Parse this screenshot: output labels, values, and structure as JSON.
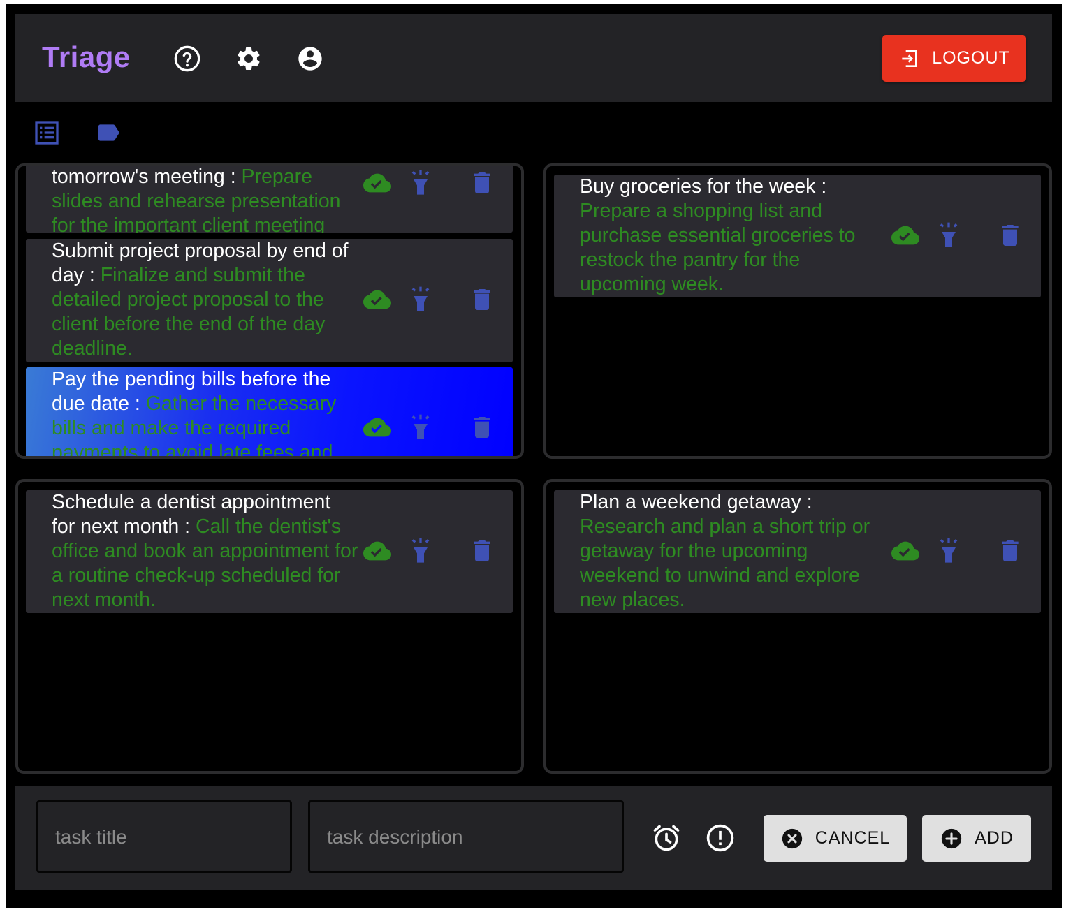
{
  "app": {
    "title": "Triage",
    "logout_label": "LOGOUT",
    "colors": {
      "brand": "#b07cf5",
      "logout": "#e8321f",
      "description_text": "#2e8b22",
      "icon_blue": "#3f51b5",
      "cloud_green": "#2e8b22"
    }
  },
  "header_icons": [
    "help-circle-icon",
    "gear-icon",
    "account-circle-icon"
  ],
  "view_icons": [
    "list-icon",
    "label-icon"
  ],
  "panels": [
    {
      "cards": [
        {
          "title": "tomorrow's meeting",
          "sep": " : ",
          "description": "Prepare slides and rehearse presentation for the important client meeting"
        },
        {
          "title": "Submit project proposal by end of day",
          "sep": " : ",
          "description": "Finalize and submit the detailed project proposal to the client before the end of the day deadline."
        },
        {
          "title": "Pay the pending bills before the due date",
          "sep": " : ",
          "description": "Gather the necessary bills and make the required payments to avoid late fees and"
        }
      ]
    },
    {
      "cards": [
        {
          "title": "Buy groceries for the week",
          "sep": " : ",
          "description": "Prepare a shopping list and purchase essential groceries to restock the pantry for the upcoming week."
        }
      ]
    },
    {
      "cards": [
        {
          "title": "Schedule a dentist appointment for next month",
          "sep": " : ",
          "description": "Call the dentist's office and book an appointment for a routine check-up scheduled for next month."
        }
      ]
    },
    {
      "cards": [
        {
          "title": "Plan a weekend getaway",
          "sep": " : ",
          "description": "Research and plan a short trip or getaway for the upcoming weekend to unwind and explore new places."
        }
      ]
    }
  ],
  "card_icons": [
    "cloud-done-icon",
    "flashlight-icon",
    "delete-icon"
  ],
  "form": {
    "title_placeholder": "task title",
    "title_value": "",
    "description_placeholder": "task description",
    "description_value": "",
    "icons": [
      "alarm-icon",
      "priority-exclamation-icon"
    ],
    "cancel_label": "CANCEL",
    "add_label": "ADD"
  }
}
